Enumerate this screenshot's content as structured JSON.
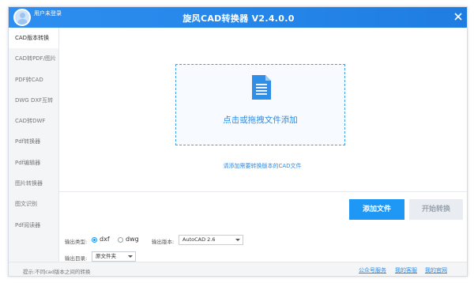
{
  "titlebar": {
    "login_text": "用户未登录",
    "app_title": "旋风CAD转换器 V2.4.0.0"
  },
  "sidebar": {
    "items": [
      {
        "label": "CAD版本转换",
        "active": true
      },
      {
        "label": "CAD转PDF/图片",
        "active": false
      },
      {
        "label": "PDF转CAD",
        "active": false
      },
      {
        "label": "DWG DXF互转",
        "active": false
      },
      {
        "label": "CAD转DWF",
        "active": false
      },
      {
        "label": "Pdf转换器",
        "active": false
      },
      {
        "label": "Pdf编辑器",
        "active": false
      },
      {
        "label": "图片转换器",
        "active": false
      },
      {
        "label": "图文识别",
        "active": false
      },
      {
        "label": "Pdf阅读器",
        "active": false
      }
    ]
  },
  "main": {
    "drop_text": "点击或拖拽文件添加",
    "hint_text": "请添加需要转换版本的CAD文件",
    "add_button": "添加文件",
    "start_button": "开始转换",
    "output_type_label": "输出类型:",
    "output_type_options": [
      "dxf",
      "dwg"
    ],
    "output_type_selected": "dxf",
    "output_version_label": "输出版本:",
    "output_version_value": "AutoCAD 2.6",
    "output_dir_label": "输出目录:",
    "output_dir_value": "原文件夹"
  },
  "statusbar": {
    "tip": "提示:不同cad版本之间的转换",
    "links": [
      "公众号服务",
      "我的客服",
      "我的官网"
    ]
  },
  "colors": {
    "accent": "#1f97f5",
    "titlebar": "#2e8ff0",
    "link": "#2d8be6",
    "disabled_button": "#e9ecf0"
  },
  "icons": [
    "user-avatar-icon",
    "close-icon",
    "file-document-icon",
    "caret-down-icon"
  ]
}
